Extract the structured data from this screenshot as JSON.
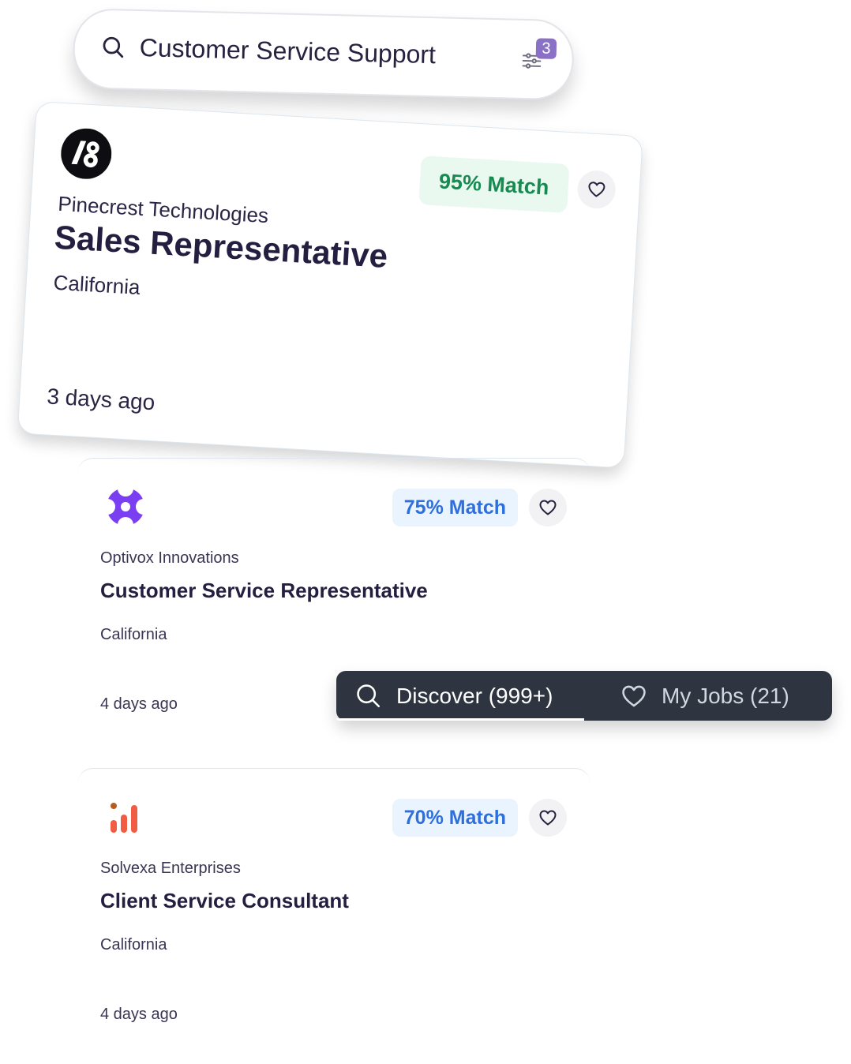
{
  "search": {
    "query": "Customer Service Support",
    "filter_count": "3",
    "icon": "search-icon"
  },
  "featured_job": {
    "company": "Pinecrest Technologies",
    "title": "Sales Representative",
    "location": "California",
    "posted": "3 days ago",
    "match": "95% Match",
    "logo": "pinecrest-logo"
  },
  "jobs": [
    {
      "company": "Optivox Innovations",
      "title": "Customer Service Representative",
      "location": "California",
      "posted": "4 days ago",
      "match": "75% Match",
      "logo": "optivox-logo"
    },
    {
      "company": "Solvexa Enterprises",
      "title": "Client Service Consultant",
      "location": "California",
      "posted": "4 days ago",
      "match": "70% Match",
      "logo": "solvexa-logo"
    }
  ],
  "nav": {
    "discover": "Discover (999+)",
    "my_jobs": "My Jobs (21)"
  },
  "colors": {
    "text": "#26223f",
    "match_high_bg": "#eaf9ef",
    "match_high_text": "#178a52",
    "match_bg": "#eaf4ff",
    "match_text": "#2f6fdb",
    "nav_bg": "#2e3440",
    "badge": "#8a70c6"
  }
}
